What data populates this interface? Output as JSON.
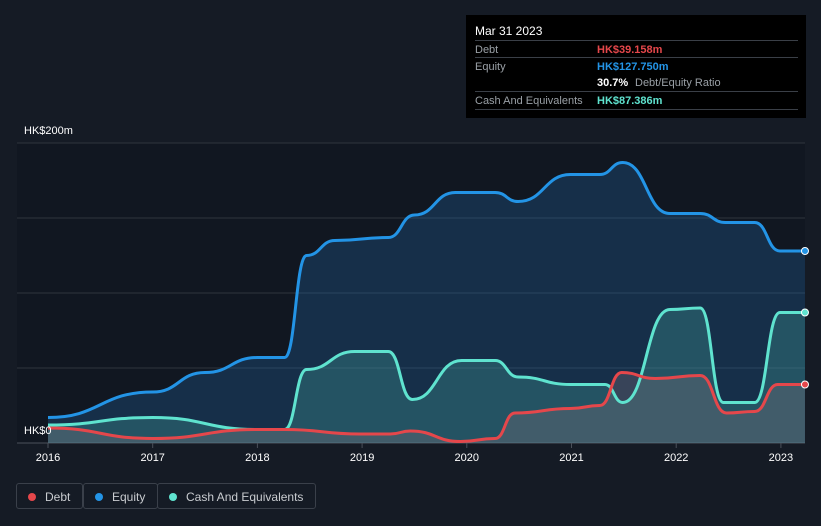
{
  "tooltip": {
    "date": "Mar 31 2023",
    "debt_label": "Debt",
    "debt_value": "HK$39.158m",
    "equity_label": "Equity",
    "equity_value": "HK$127.750m",
    "ratio_value": "30.7%",
    "ratio_label": "Debt/Equity Ratio",
    "cash_label": "Cash And Equivalents",
    "cash_value": "HK$87.386m"
  },
  "legend": [
    {
      "label": "Debt",
      "color": "#e5474b"
    },
    {
      "label": "Equity",
      "color": "#2394e6"
    },
    {
      "label": "Cash And Equivalents",
      "color": "#5fe3cf"
    }
  ],
  "chart_data": {
    "type": "area",
    "ylabel_top": "HK$200m",
    "ylabel_bottom": "HK$0",
    "ylim": [
      0,
      200
    ],
    "xlim": [
      2015.7,
      2023.23
    ],
    "xticks": [
      "2016",
      "2017",
      "2018",
      "2019",
      "2020",
      "2021",
      "2022",
      "2023"
    ],
    "series": [
      {
        "name": "Equity",
        "color": "#2394e6",
        "points": [
          [
            2016,
            17
          ],
          [
            2017,
            34
          ],
          [
            2017.5,
            47
          ],
          [
            2018,
            57
          ],
          [
            2018.26,
            57
          ],
          [
            2018.47,
            125
          ],
          [
            2018.74,
            135
          ],
          [
            2019.25,
            137
          ],
          [
            2019.5,
            152
          ],
          [
            2019.89,
            167
          ],
          [
            2020.27,
            167
          ],
          [
            2020.49,
            161
          ],
          [
            2020.99,
            179
          ],
          [
            2021.27,
            179
          ],
          [
            2021.49,
            187
          ],
          [
            2021.94,
            153
          ],
          [
            2022.23,
            153
          ],
          [
            2022.47,
            147
          ],
          [
            2022.75,
            147
          ],
          [
            2022.99,
            128
          ],
          [
            2023.23,
            128
          ]
        ]
      },
      {
        "name": "Cash And Equivalents",
        "color": "#5fe3cf",
        "points": [
          [
            2016,
            12
          ],
          [
            2017,
            17
          ],
          [
            2018,
            9
          ],
          [
            2018.26,
            9
          ],
          [
            2018.47,
            49
          ],
          [
            2018.93,
            61
          ],
          [
            2019.25,
            61
          ],
          [
            2019.48,
            29
          ],
          [
            2019.95,
            55
          ],
          [
            2020.27,
            55
          ],
          [
            2020.49,
            44
          ],
          [
            2020.99,
            39
          ],
          [
            2021.32,
            39
          ],
          [
            2021.49,
            27
          ],
          [
            2021.94,
            89
          ],
          [
            2022.23,
            90
          ],
          [
            2022.45,
            27
          ],
          [
            2022.75,
            27
          ],
          [
            2022.99,
            87
          ],
          [
            2023.23,
            87
          ]
        ]
      },
      {
        "name": "Debt",
        "color": "#e5474b",
        "points": [
          [
            2016,
            10
          ],
          [
            2017,
            3
          ],
          [
            2018,
            9
          ],
          [
            2018.26,
            9
          ],
          [
            2018.98,
            6
          ],
          [
            2019.27,
            6
          ],
          [
            2019.46,
            8
          ],
          [
            2019.94,
            1
          ],
          [
            2020.27,
            3
          ],
          [
            2020.46,
            20
          ],
          [
            2020.99,
            23
          ],
          [
            2021.27,
            25
          ],
          [
            2021.48,
            47
          ],
          [
            2021.8,
            43
          ],
          [
            2022.23,
            45
          ],
          [
            2022.48,
            20
          ],
          [
            2022.75,
            21
          ],
          [
            2022.97,
            39
          ],
          [
            2023.23,
            39
          ]
        ]
      }
    ]
  }
}
